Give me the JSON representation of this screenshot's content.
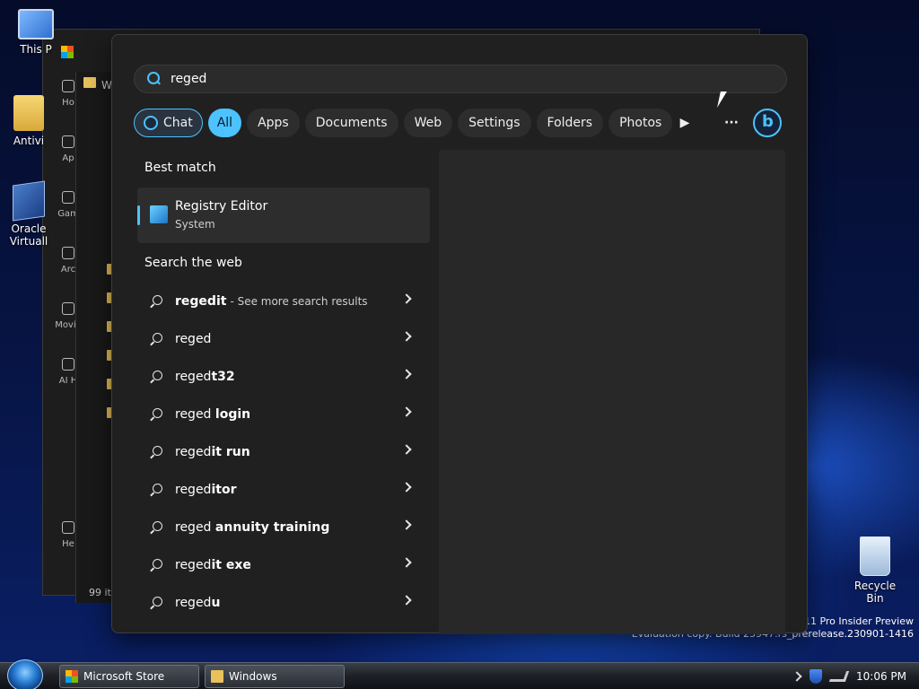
{
  "desktop": {
    "icons": [
      {
        "label": "This P"
      },
      {
        "label": "Antivi"
      },
      {
        "label": "Oracle Virtuall"
      },
      {
        "label": "Recycle Bin"
      }
    ],
    "watermark": {
      "line1": "s 11 Pro Insider Preview",
      "line2": "Evaluation copy. Build 25947.rs_prerelease.230901-1416"
    }
  },
  "background_windows": {
    "store_side_labels": [
      "Ho",
      "Ap",
      "Gam",
      "Arc",
      "Movie",
      "AI H",
      "He"
    ],
    "explorer_status": "99 ite",
    "explorer_tab": "W"
  },
  "search": {
    "query": "reged",
    "filters": [
      {
        "label": "Chat"
      },
      {
        "label": "All"
      },
      {
        "label": "Apps"
      },
      {
        "label": "Documents"
      },
      {
        "label": "Web"
      },
      {
        "label": "Settings"
      },
      {
        "label": "Folders"
      },
      {
        "label": "Photos"
      }
    ],
    "best_match_title": "Best match",
    "best_match": {
      "name": "Registry Editor",
      "type": "System"
    },
    "web_title": "Search the web",
    "web_results": [
      {
        "base": "regedit",
        "bold": "",
        "more": "- See more search results"
      },
      {
        "base": "reged",
        "bold": "",
        "more": ""
      },
      {
        "base": "reged",
        "bold": "t32",
        "more": ""
      },
      {
        "base": "reged ",
        "bold": "login",
        "more": ""
      },
      {
        "base": "reged",
        "bold": "it run",
        "more": ""
      },
      {
        "base": "reged",
        "bold": "itor",
        "more": ""
      },
      {
        "base": "reged ",
        "bold": "annuity training",
        "more": ""
      },
      {
        "base": "reged",
        "bold": "it exe",
        "more": ""
      },
      {
        "base": "reged",
        "bold": "u",
        "more": ""
      }
    ],
    "more_icon": "ellipsis-icon",
    "play_icon": "play-icon"
  },
  "taskbar": {
    "items": [
      {
        "label": "Microsoft Store"
      },
      {
        "label": "Windows"
      }
    ],
    "clock": "10:06 PM"
  },
  "colors": {
    "accent": "#4cc2ff",
    "panel_bg": "#202020"
  }
}
